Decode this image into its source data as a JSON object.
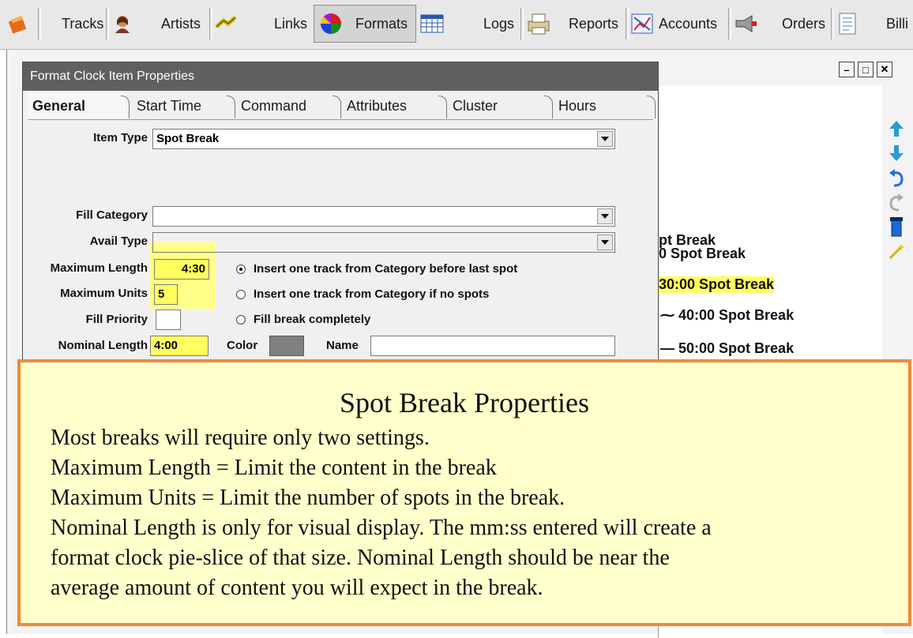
{
  "toolbar": {
    "items": [
      {
        "label": "",
        "icon": "paint-bucket-icon"
      },
      {
        "label": "Tracks",
        "icon": "music-notes-icon"
      },
      {
        "label": "Artists",
        "icon": "artist-portrait-icon"
      },
      {
        "label": "Links",
        "icon": "chain-link-icon"
      },
      {
        "label": "Formats",
        "icon": "pie-clock-icon"
      },
      {
        "label": "Logs",
        "icon": "calendar-grid-icon"
      },
      {
        "label": "Reports",
        "icon": "printer-icon"
      },
      {
        "label": "Accounts",
        "icon": "chart-icon"
      },
      {
        "label": "Orders",
        "icon": "megaphone-icon"
      },
      {
        "label": "Billi",
        "icon": "document-icon"
      }
    ],
    "active": "Formats"
  },
  "background_window": {
    "clock_items": [
      {
        "text": "pt Break",
        "highlight": false
      },
      {
        "text": "0 Spot Break",
        "highlight": false
      },
      {
        "text": "30:00 Spot Break",
        "highlight": true
      },
      {
        "text": "40:00 Spot Break",
        "highlight": false
      },
      {
        "text": "50:00 Spot Break",
        "highlight": false
      }
    ],
    "window_controls": [
      "minimize",
      "maximize",
      "close"
    ]
  },
  "dialog": {
    "title": "Format Clock Item Properties",
    "tabs": [
      "General",
      "Start Time",
      "Command",
      "Attributes",
      "Cluster",
      "Hours"
    ],
    "active_tab": "General",
    "fields": {
      "item_type": {
        "label": "Item Type",
        "value": "Spot Break"
      },
      "fill_category": {
        "label": "Fill Category",
        "value": ""
      },
      "avail_type": {
        "label": "Avail Type",
        "value": ""
      },
      "maximum_length": {
        "label": "Maximum Length",
        "value": "4:30"
      },
      "maximum_units": {
        "label": "Maximum Units",
        "value": "5"
      },
      "fill_priority": {
        "label": "Fill Priority",
        "value": ""
      },
      "nominal_length": {
        "label": "Nominal Length",
        "value": "4:00"
      },
      "color": {
        "label": "Color",
        "value": "#808080"
      },
      "name": {
        "label": "Name",
        "value": ""
      }
    },
    "radio_options": [
      {
        "label": "Insert one track from Category before last spot",
        "selected": true
      },
      {
        "label": "Insert one track from Category if no spots",
        "selected": false
      },
      {
        "label": "Fill break completely",
        "selected": false
      }
    ]
  },
  "callout": {
    "title": "Spot Break Properties",
    "lines": [
      "Most breaks will require only two settings.",
      "Maximum Length = Limit the content in the break",
      "Maximum Units = Limit the number of spots in the break.",
      "Nominal Length is only for visual display.  The mm:ss entered will create a",
      "format clock pie-slice of that size. Nominal Length should be near the",
      "average amount of content you will expect in the break."
    ]
  },
  "colors": {
    "highlight": "#ffff60",
    "callout_bg": "#ffffcc",
    "callout_border": "#ef8a3a",
    "dialog_title_bg": "#606060"
  }
}
